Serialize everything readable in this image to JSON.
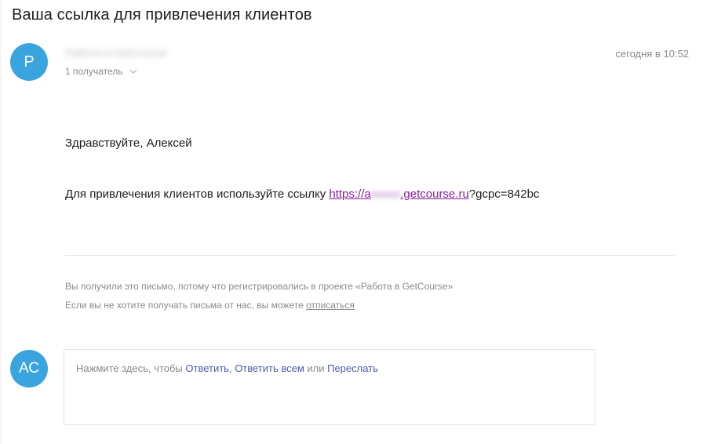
{
  "subject": "Ваша ссылка для привлечения клиентов",
  "sender": {
    "initial": "P",
    "name_redacted": "Работа в GetCourse",
    "recipients_label": "1 получатель",
    "avatar_color": "#3aa4df"
  },
  "date": "сегодня в 10:52",
  "message": {
    "greeting": "Здравствуйте, Алексей",
    "intro": "Для привлечения клиентов используйте ссылку ",
    "link_prefix": "https://a",
    "link_redacted": "xxxxx",
    "link_domain": ".getcourse.ru",
    "link_query": "?gcpc=842bc",
    "link_color": "#8a1ea0"
  },
  "footer": {
    "line1": "Вы получили это письмо, потому что регистрировались в проекте «Работа в GetCourse»",
    "line2_prefix": "Если вы не хотите получать письма от нас, вы можете ",
    "unsubscribe": "отписаться"
  },
  "reply": {
    "avatar_initials": "АС",
    "avatar_color": "#3aa4df",
    "prompt_prefix": "Нажмите здесь, чтобы ",
    "reply_action": "Ответить",
    "separator": ", ",
    "reply_all_action": "Ответить всем",
    "or_word": " или ",
    "forward_action": "Переслать",
    "action_color": "#4a5aa8"
  },
  "icons": {
    "recipients_toggle": "chevron-down-icon"
  }
}
